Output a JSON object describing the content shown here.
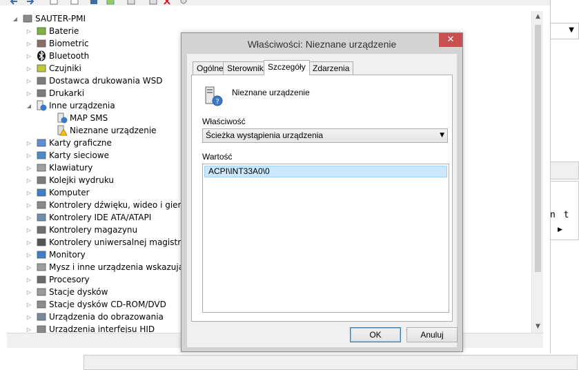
{
  "tree": {
    "root": "SAUTER-PMI",
    "items": [
      {
        "label": "Baterie",
        "icon": "battery-icon",
        "state": "collapsed",
        "level": 1
      },
      {
        "label": "Biometric",
        "icon": "fingerprint-icon",
        "state": "collapsed",
        "level": 1
      },
      {
        "label": "Bluetooth",
        "icon": "bluetooth-icon",
        "state": "collapsed",
        "level": 1
      },
      {
        "label": "Czujniki",
        "icon": "sensor-icon",
        "state": "collapsed",
        "level": 1
      },
      {
        "label": "Dostawca drukowania WSD",
        "icon": "printer-icon",
        "state": "collapsed",
        "level": 1
      },
      {
        "label": "Drukarki",
        "icon": "printer-icon",
        "state": "collapsed",
        "level": 1
      },
      {
        "label": "Inne urządzenia",
        "icon": "unknown-device-icon",
        "state": "expanded",
        "level": 1
      },
      {
        "label": "MAP SMS",
        "icon": "unknown-device-icon",
        "state": "leaf",
        "level": 2
      },
      {
        "label": "Nieznane urządzenie",
        "icon": "warning-device-icon",
        "state": "leaf",
        "level": 2
      },
      {
        "label": "Karty graficzne",
        "icon": "display-adapter-icon",
        "state": "collapsed",
        "level": 1
      },
      {
        "label": "Karty sieciowe",
        "icon": "network-adapter-icon",
        "state": "collapsed",
        "level": 1
      },
      {
        "label": "Klawiatury",
        "icon": "keyboard-icon",
        "state": "collapsed",
        "level": 1
      },
      {
        "label": "Kolejki wydruku",
        "icon": "printer-icon",
        "state": "collapsed",
        "level": 1
      },
      {
        "label": "Komputer",
        "icon": "computer-icon",
        "state": "collapsed",
        "level": 1
      },
      {
        "label": "Kontrolery dźwięku, wideo i gier",
        "icon": "speaker-icon",
        "state": "collapsed",
        "level": 1
      },
      {
        "label": "Kontrolery IDE ATA/ATAPI",
        "icon": "ide-controller-icon",
        "state": "collapsed",
        "level": 1
      },
      {
        "label": "Kontrolery magazynu",
        "icon": "storage-controller-icon",
        "state": "collapsed",
        "level": 1
      },
      {
        "label": "Kontrolery uniwersalnej magistrali s",
        "icon": "usb-icon",
        "state": "collapsed",
        "level": 1
      },
      {
        "label": "Monitory",
        "icon": "monitor-icon",
        "state": "collapsed",
        "level": 1
      },
      {
        "label": "Mysz i inne urządzenia wskazujące",
        "icon": "mouse-icon",
        "state": "collapsed",
        "level": 1
      },
      {
        "label": "Procesory",
        "icon": "processor-icon",
        "state": "collapsed",
        "level": 1
      },
      {
        "label": "Stacje dysków",
        "icon": "disk-drive-icon",
        "state": "collapsed",
        "level": 1
      },
      {
        "label": "Stacje dysków CD-ROM/DVD",
        "icon": "cdrom-icon",
        "state": "collapsed",
        "level": 1
      },
      {
        "label": "Urządzenia do obrazowania",
        "icon": "scanner-icon",
        "state": "collapsed",
        "level": 1
      },
      {
        "label": "Urządzenia interfejsu HID",
        "icon": "hid-icon",
        "state": "collapsed",
        "level": 1
      }
    ]
  },
  "right_fragment": {
    "text": "n t"
  },
  "dialog": {
    "title": "Właściwości: Nieznane urządzenie",
    "close": "✕",
    "tabs": [
      "Ogólne",
      "Sterownik",
      "Szczegóły",
      "Zdarzenia"
    ],
    "active_tab": "Szczegóły",
    "device_name": "Nieznane urządzenie",
    "property_label": "Właściwość",
    "property_value": "Ścieżka wystąpienia urządzenia",
    "value_label": "Wartość",
    "value_item": "ACPI\\INT33A0\\0",
    "ok": "OK",
    "cancel": "Anuluj"
  },
  "colors": {
    "close_button": "#c75050",
    "selection": "#cce8ff",
    "dialog_frame": "#d3d3d3"
  }
}
